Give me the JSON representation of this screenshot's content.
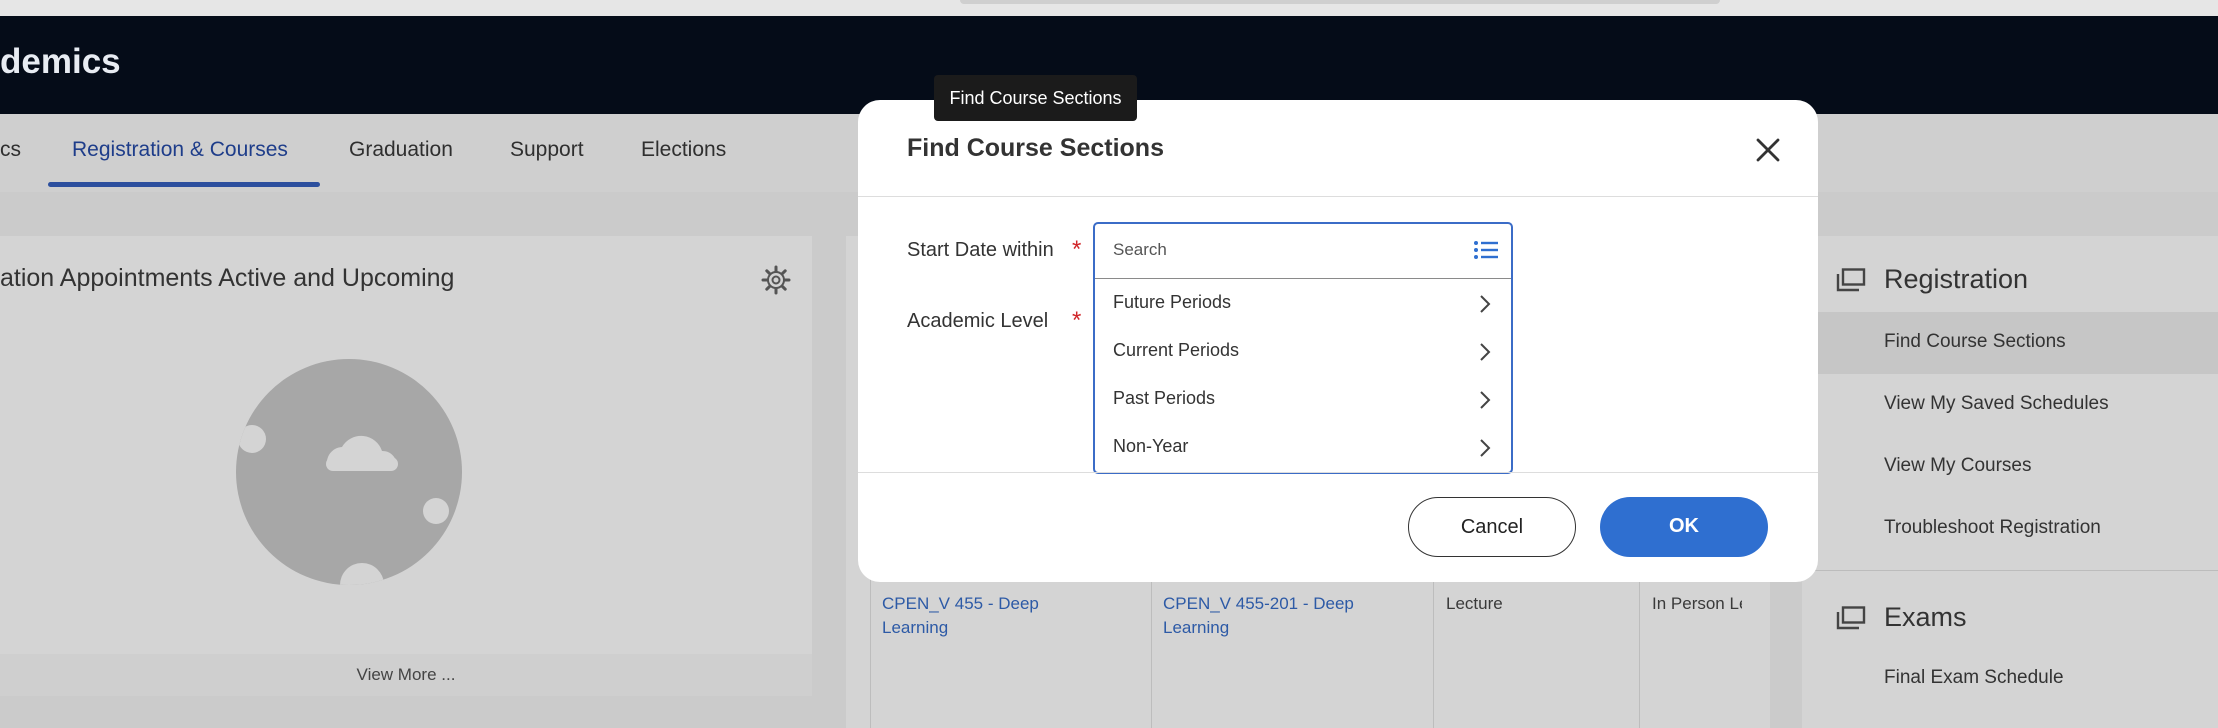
{
  "header": {
    "title": "demics"
  },
  "tabs": [
    {
      "label": "cs"
    },
    {
      "label": "Registration & Courses",
      "active": true
    },
    {
      "label": "Graduation"
    },
    {
      "label": "Support"
    },
    {
      "label": "Elections"
    }
  ],
  "left_card": {
    "title": "ation Appointments Active and Upcoming",
    "view_more": "View More ..."
  },
  "table_row": {
    "course": "CPEN_V 455 - Deep Learning",
    "section": "CPEN_V 455-201 - Deep Learning",
    "format": "Lecture",
    "delivery": "In Person Le"
  },
  "right_panel": {
    "registration_title": "Registration",
    "registration_links": [
      "Find Course Sections",
      "View My Saved Schedules",
      "View My Courses",
      "Troubleshoot Registration"
    ],
    "exams_title": "Exams",
    "exams_links": [
      "Final Exam Schedule"
    ]
  },
  "tooltip": {
    "text": "Find Course Sections"
  },
  "modal": {
    "title": "Find Course Sections",
    "fields": [
      {
        "label": "Start Date within",
        "required": "*"
      },
      {
        "label": "Academic Level",
        "required": "*"
      }
    ],
    "search_placeholder": "Search",
    "options": [
      "Future Periods",
      "Current Periods",
      "Past Periods",
      "Non-Year"
    ],
    "cancel_label": "Cancel",
    "ok_label": "OK"
  },
  "colors": {
    "primary": "#2f6fd0",
    "required": "#d0262a",
    "header_bg": "#050c18"
  }
}
